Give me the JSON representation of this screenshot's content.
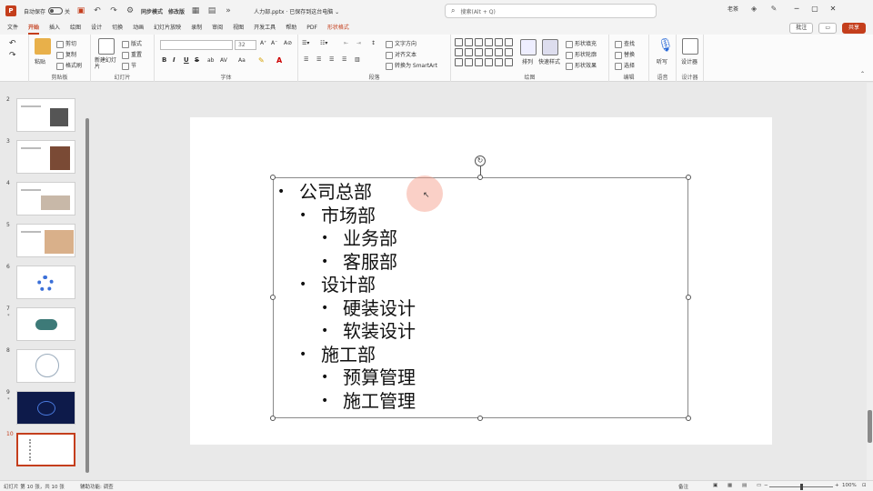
{
  "titlebar": {
    "autosave_label": "自动保存",
    "autosave_state": "关",
    "qa_labels": [
      "同步模式",
      "修改版"
    ],
    "doc_title": "人力部.pptx · 已保存到这台电脑 ⌄",
    "search_placeholder": "搜索(Alt + Q)",
    "user_name": "老茶",
    "brand_color": "#c43e1c"
  },
  "tabs": {
    "items": [
      "文件",
      "开始",
      "插入",
      "绘图",
      "设计",
      "切换",
      "动画",
      "幻灯片放映",
      "录制",
      "审阅",
      "视图",
      "开发工具",
      "帮助",
      "PDF",
      "形状格式"
    ],
    "active_index": 1,
    "contextual_index": 14,
    "comment_btn": "批注",
    "share_btn": "共享"
  },
  "ribbon": {
    "groups": [
      "剪贴板",
      "幻灯片",
      "字体",
      "段落",
      "绘图",
      "编辑",
      "语音",
      "设计器"
    ],
    "clipboard": {
      "paste": "粘贴",
      "cut": "剪切",
      "copy": "复制",
      "format_painter": "格式刷"
    },
    "slides": {
      "new_slide": "新建幻灯片",
      "layout": "版式",
      "reset": "重置",
      "section": "节"
    },
    "font": {
      "font_name": "",
      "font_size": "32",
      "bold": "B",
      "italic": "I",
      "underline": "U",
      "strike": "S"
    },
    "paragraph": {
      "text_direction": "文字方向",
      "align_text": "对齐文本",
      "smartart": "转换为 SmartArt"
    },
    "drawing": {
      "arrange": "排列",
      "quick_styles": "快速样式",
      "fill": "形状填充",
      "outline": "形状轮廓",
      "effects": "形状效果"
    },
    "editing": {
      "find": "查找",
      "replace": "替换",
      "select": "选择"
    },
    "voice": {
      "dictate": "听写"
    },
    "designer": {
      "designer": "设计器"
    }
  },
  "thumbnails": {
    "numbers": [
      "2",
      "3",
      "4",
      "5",
      "6",
      "7",
      "8",
      "9",
      "10"
    ],
    "active_number": "10"
  },
  "slide": {
    "bullets": [
      {
        "level": 0,
        "text": "公司总部"
      },
      {
        "level": 1,
        "text": "市场部"
      },
      {
        "level": 2,
        "text": "业务部"
      },
      {
        "level": 2,
        "text": "客服部"
      },
      {
        "level": 1,
        "text": "设计部"
      },
      {
        "level": 2,
        "text": "硬装设计"
      },
      {
        "level": 2,
        "text": "软装设计"
      },
      {
        "level": 1,
        "text": "施工部"
      },
      {
        "level": 2,
        "text": "预算管理"
      },
      {
        "level": 2,
        "text": "施工管理"
      }
    ]
  },
  "statusbar": {
    "slide_info": "幻灯片 第 10 张，共 10 张",
    "accessibility": "辅助功能: 调查",
    "notes": "备注",
    "zoom": "100%"
  }
}
